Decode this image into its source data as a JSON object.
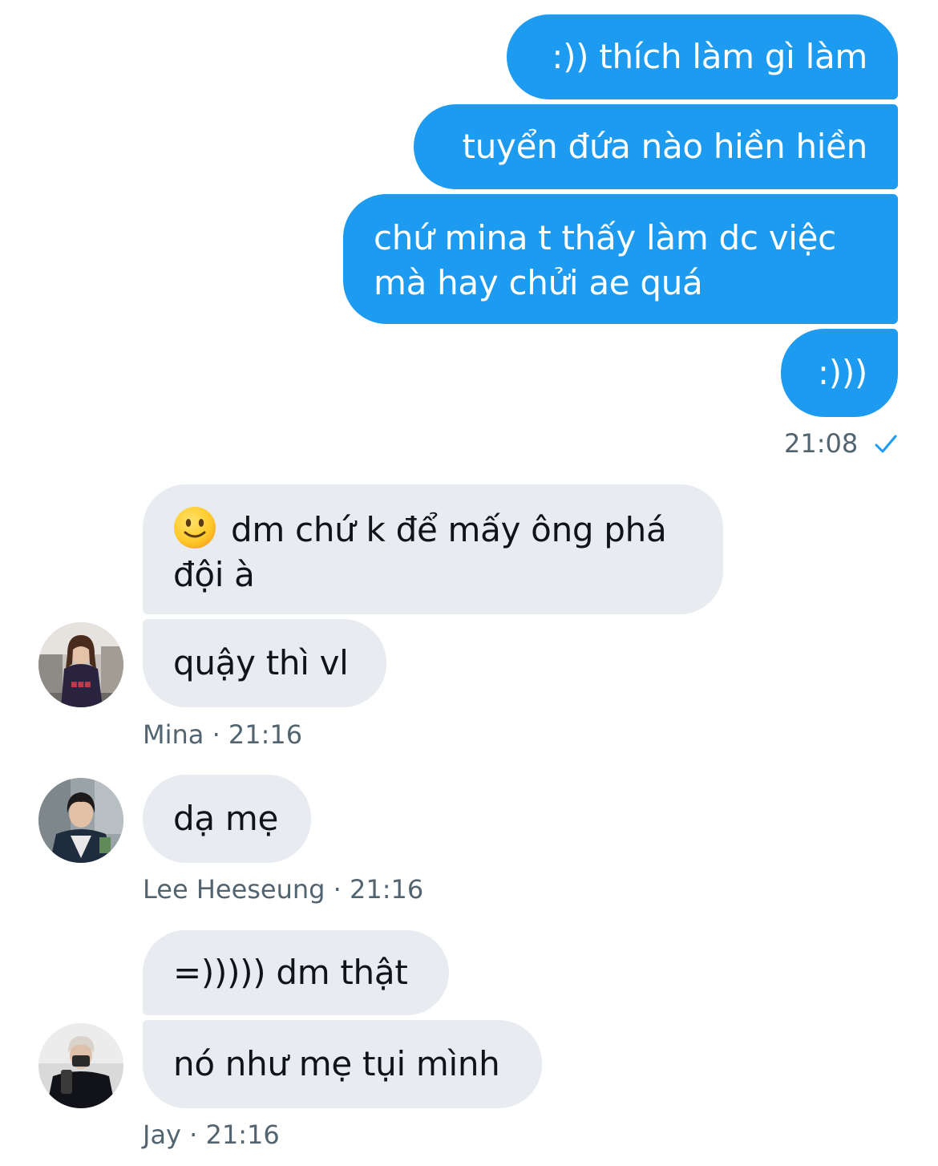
{
  "colors": {
    "outgoing_bubble": "#1d9bf0",
    "incoming_bubble": "#e8ebf0",
    "meta_text": "#536471",
    "read_check": "#1d9bf0"
  },
  "outgoing": {
    "messages": [
      ":)) thích làm gì làm",
      "tuyển đứa nào hiền hiền",
      "chứ mina t thấy làm dc việc mà hay chửi ae quá",
      ":)))"
    ],
    "time": "21:08",
    "status_icon": "check-icon"
  },
  "incoming": [
    {
      "sender": "Mina",
      "separator": " · ",
      "time": "21:16",
      "avatar_icon": "avatar-mina",
      "messages": [
        "dm chứ k để mấy ông phá đội à",
        "quậy thì vl"
      ],
      "emoji_icon": "slightly-smiling-face-icon"
    },
    {
      "sender": "Lee Heeseung",
      "separator": " · ",
      "time": "21:16",
      "avatar_icon": "avatar-lee-heeseung",
      "messages": [
        "dạ mẹ"
      ]
    },
    {
      "sender": "Jay",
      "separator": " · ",
      "time": "21:16",
      "avatar_icon": "avatar-jay",
      "messages": [
        "=))))) dm thật",
        "nó như mẹ tụi mình"
      ]
    }
  ]
}
